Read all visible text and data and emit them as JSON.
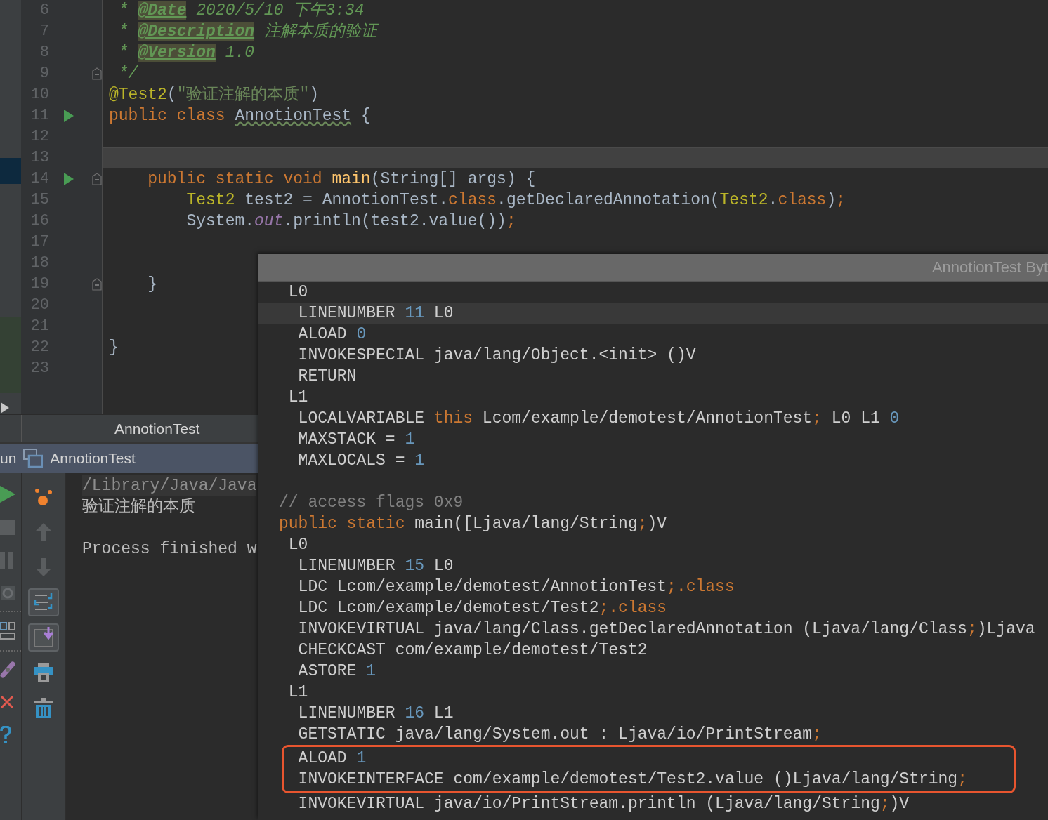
{
  "editor": {
    "code_lines": [
      {
        "number": "6",
        "run_marker": false,
        "fold": false,
        "current": false,
        "segments": [
          {
            "kind": "comment",
            "text": " * "
          },
          {
            "kind": "doctag",
            "text": "@Date"
          },
          {
            "kind": "comment",
            "text": " 2020/5/10 下午3:34"
          }
        ]
      },
      {
        "number": "7",
        "run_marker": false,
        "fold": false,
        "current": false,
        "segments": [
          {
            "kind": "comment",
            "text": " * "
          },
          {
            "kind": "doctag",
            "text": "@Description"
          },
          {
            "kind": "comment",
            "text": " 注解本质的验证"
          }
        ]
      },
      {
        "number": "8",
        "run_marker": false,
        "fold": false,
        "current": false,
        "segments": [
          {
            "kind": "comment",
            "text": " * "
          },
          {
            "kind": "doctag",
            "text": "@Version"
          },
          {
            "kind": "comment",
            "text": " 1.0"
          }
        ]
      },
      {
        "number": "9",
        "run_marker": false,
        "fold": true,
        "current": false,
        "segments": [
          {
            "kind": "comment",
            "text": " */"
          }
        ]
      },
      {
        "number": "10",
        "run_marker": false,
        "fold": false,
        "current": false,
        "segments": [
          {
            "kind": "annotation",
            "text": "@Test2"
          },
          {
            "kind": "plain",
            "text": "("
          },
          {
            "kind": "string",
            "text": "\"验证注解的本质\""
          },
          {
            "kind": "plain",
            "text": ")"
          }
        ]
      },
      {
        "number": "11",
        "run_marker": true,
        "fold": false,
        "current": false,
        "segments": [
          {
            "kind": "keyword",
            "text": "public class "
          },
          {
            "kind": "typo",
            "text": "AnnotionTest"
          },
          {
            "kind": "plain",
            "text": " {"
          }
        ]
      },
      {
        "number": "12",
        "run_marker": false,
        "fold": false,
        "current": false
      },
      {
        "number": "13",
        "run_marker": false,
        "fold": false,
        "current": true
      },
      {
        "number": "14",
        "run_marker": true,
        "fold": true,
        "current": false,
        "segments": [
          {
            "kind": "keyword",
            "text": "    public static void "
          },
          {
            "kind": "method",
            "text": "main"
          },
          {
            "kind": "plain",
            "text": "(String[] args) {"
          }
        ]
      },
      {
        "number": "15",
        "run_marker": false,
        "fold": false,
        "current": false,
        "segments": [
          {
            "kind": "annotation",
            "text": "        Test2"
          },
          {
            "kind": "plain",
            "text": " test2 = AnnotionTest."
          },
          {
            "kind": "keyword",
            "text": "class"
          },
          {
            "kind": "plain",
            "text": ".getDeclaredAnnotation("
          },
          {
            "kind": "annotation",
            "text": "Test2"
          },
          {
            "kind": "plain",
            "text": "."
          },
          {
            "kind": "keyword",
            "text": "class"
          },
          {
            "kind": "plain",
            "text": ")"
          },
          {
            "kind": "keyword",
            "text": ";"
          }
        ]
      },
      {
        "number": "16",
        "run_marker": false,
        "fold": false,
        "current": false,
        "segments": [
          {
            "kind": "plain",
            "text": "        System."
          },
          {
            "kind": "field",
            "text": "out"
          },
          {
            "kind": "plain",
            "text": ".println(test2.value())"
          },
          {
            "kind": "keyword",
            "text": ";"
          }
        ]
      },
      {
        "number": "17",
        "run_marker": false,
        "fold": false,
        "current": false
      },
      {
        "number": "18",
        "run_marker": false,
        "fold": false,
        "current": false
      },
      {
        "number": "19",
        "run_marker": false,
        "fold": true,
        "current": false,
        "segments": [
          {
            "kind": "plain",
            "text": "    }"
          }
        ]
      },
      {
        "number": "20",
        "run_marker": false,
        "fold": false,
        "current": false
      },
      {
        "number": "21",
        "run_marker": false,
        "fold": false,
        "current": false
      },
      {
        "number": "22",
        "run_marker": false,
        "fold": false,
        "current": false,
        "segments": [
          {
            "kind": "plain",
            "text": "}"
          }
        ]
      },
      {
        "number": "23",
        "run_marker": false,
        "fold": false,
        "current": false
      }
    ],
    "tab": "AnnotionTest"
  },
  "run_panel": {
    "title_prefix": "un",
    "title": "AnnotionTest",
    "left_tools": [
      {
        "kind": "run"
      },
      {
        "kind": "stop"
      },
      {
        "kind": "pause"
      },
      {
        "kind": "camera"
      },
      {
        "kind": "separator"
      },
      {
        "kind": "layout"
      },
      {
        "kind": "separator"
      },
      {
        "kind": "plug"
      },
      {
        "kind": "close"
      },
      {
        "kind": "help"
      }
    ],
    "tools": [
      {
        "kind": "dots",
        "on": false
      },
      {
        "kind": "up",
        "on": false
      },
      {
        "kind": "down",
        "on": false
      },
      {
        "kind": "wrap",
        "on": true
      },
      {
        "kind": "scroll",
        "on": true
      },
      {
        "kind": "print",
        "on": false
      },
      {
        "kind": "trash",
        "on": false
      }
    ],
    "console": [
      {
        "kind": "command",
        "text": "/Library/Java/Java"
      },
      {
        "kind": "output",
        "text": "验证注解的本质"
      },
      {
        "kind": "blank"
      },
      {
        "kind": "output",
        "text": "Process finished w"
      }
    ]
  },
  "bytecode_popup": {
    "title": "AnnotionTest Byt",
    "lines": [
      {
        "current": false,
        "boxed": false,
        "segments": [
          {
            "kind": "plain",
            "text": " L0"
          }
        ]
      },
      {
        "current": true,
        "boxed": false,
        "segments": [
          {
            "kind": "plain",
            "text": "  LINENUMBER "
          },
          {
            "kind": "number",
            "text": "11"
          },
          {
            "kind": "plain",
            "text": " L0"
          }
        ]
      },
      {
        "current": false,
        "boxed": false,
        "segments": [
          {
            "kind": "plain",
            "text": "  ALOAD "
          },
          {
            "kind": "number",
            "text": "0"
          }
        ]
      },
      {
        "current": false,
        "boxed": false,
        "segments": [
          {
            "kind": "plain",
            "text": "  INVOKESPECIAL java/lang/Object.<init> ()V"
          }
        ]
      },
      {
        "current": false,
        "boxed": false,
        "segments": [
          {
            "kind": "plain",
            "text": "  RETURN"
          }
        ]
      },
      {
        "current": false,
        "boxed": false,
        "segments": [
          {
            "kind": "plain",
            "text": " L1"
          }
        ]
      },
      {
        "current": false,
        "boxed": false,
        "segments": [
          {
            "kind": "plain",
            "text": "  LOCALVARIABLE "
          },
          {
            "kind": "keyword",
            "text": "this"
          },
          {
            "kind": "plain",
            "text": " Lcom/example/demotest/AnnotionTest"
          },
          {
            "kind": "keyword",
            "text": ";"
          },
          {
            "kind": "plain",
            "text": " L0 L1 "
          },
          {
            "kind": "number",
            "text": "0"
          }
        ]
      },
      {
        "current": false,
        "boxed": false,
        "segments": [
          {
            "kind": "plain",
            "text": "  MAXSTACK = "
          },
          {
            "kind": "number",
            "text": "1"
          }
        ]
      },
      {
        "current": false,
        "boxed": false,
        "segments": [
          {
            "kind": "plain",
            "text": "  MAXLOCALS = "
          },
          {
            "kind": "number",
            "text": "1"
          }
        ]
      },
      {
        "current": false,
        "boxed": false
      },
      {
        "current": false,
        "boxed": false,
        "segments": [
          {
            "kind": "comment",
            "text": "// access flags 0x9"
          }
        ]
      },
      {
        "current": false,
        "boxed": false,
        "segments": [
          {
            "kind": "keyword",
            "text": "public static "
          },
          {
            "kind": "plain",
            "text": "main([Ljava/lang/String"
          },
          {
            "kind": "keyword",
            "text": ";"
          },
          {
            "kind": "plain",
            "text": ")V"
          }
        ]
      },
      {
        "current": false,
        "boxed": false,
        "segments": [
          {
            "kind": "plain",
            "text": " L0"
          }
        ]
      },
      {
        "current": false,
        "boxed": false,
        "segments": [
          {
            "kind": "plain",
            "text": "  LINENUMBER "
          },
          {
            "kind": "number",
            "text": "15"
          },
          {
            "kind": "plain",
            "text": " L0"
          }
        ]
      },
      {
        "current": false,
        "boxed": false,
        "segments": [
          {
            "kind": "plain",
            "text": "  LDC Lcom/example/demotest/AnnotionTest"
          },
          {
            "kind": "keyword",
            "text": ";.class"
          }
        ]
      },
      {
        "current": false,
        "boxed": false,
        "segments": [
          {
            "kind": "plain",
            "text": "  LDC Lcom/example/demotest/Test2"
          },
          {
            "kind": "keyword",
            "text": ";.class"
          }
        ]
      },
      {
        "current": false,
        "boxed": false,
        "segments": [
          {
            "kind": "plain",
            "text": "  INVOKEVIRTUAL java/lang/Class.getDeclaredAnnotation (Ljava/lang/Class"
          },
          {
            "kind": "keyword",
            "text": ";"
          },
          {
            "kind": "plain",
            "text": ")Ljava"
          }
        ]
      },
      {
        "current": false,
        "boxed": false,
        "segments": [
          {
            "kind": "plain",
            "text": "  CHECKCAST com/example/demotest/Test2"
          }
        ]
      },
      {
        "current": false,
        "boxed": false,
        "segments": [
          {
            "kind": "plain",
            "text": "  ASTORE "
          },
          {
            "kind": "number",
            "text": "1"
          }
        ]
      },
      {
        "current": false,
        "boxed": false,
        "segments": [
          {
            "kind": "plain",
            "text": " L1"
          }
        ]
      },
      {
        "current": false,
        "boxed": false,
        "segments": [
          {
            "kind": "plain",
            "text": "  LINENUMBER "
          },
          {
            "kind": "number",
            "text": "16"
          },
          {
            "kind": "plain",
            "text": " L1"
          }
        ]
      },
      {
        "current": false,
        "boxed": false,
        "segments": [
          {
            "kind": "plain",
            "text": "  GETSTATIC java/lang/System.out : Ljava/io/PrintStream"
          },
          {
            "kind": "keyword",
            "text": ";"
          }
        ]
      },
      {
        "current": false,
        "boxed": true,
        "segments": [
          {
            "kind": "plain",
            "text": "  ALOAD "
          },
          {
            "kind": "number",
            "text": "1"
          }
        ]
      },
      {
        "current": false,
        "boxed": true,
        "segments": [
          {
            "kind": "plain",
            "text": "  INVOKEINTERFACE com/example/demotest/Test2.value ()Ljava/lang/String"
          },
          {
            "kind": "keyword",
            "text": ";"
          }
        ]
      },
      {
        "current": false,
        "boxed": false,
        "segments": [
          {
            "kind": "plain",
            "text": "  INVOKEVIRTUAL java/io/PrintStream.println (Ljava/lang/String"
          },
          {
            "kind": "keyword",
            "text": ";"
          },
          {
            "kind": "plain",
            "text": ")V"
          }
        ]
      }
    ]
  }
}
